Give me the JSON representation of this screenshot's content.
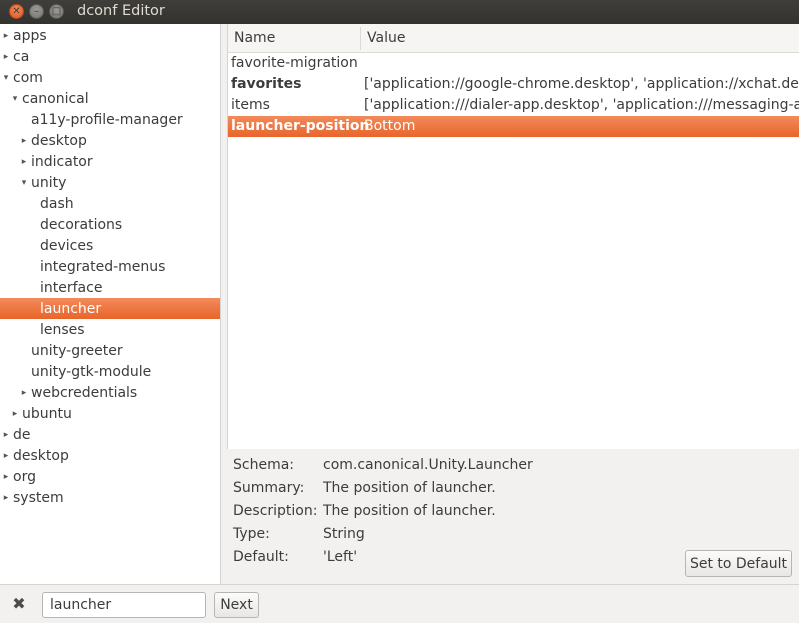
{
  "window": {
    "title": "dconf Editor",
    "close_glyph": "✕",
    "min_glyph": "–",
    "max_glyph": "□"
  },
  "tree": {
    "items": [
      {
        "label": "apps",
        "arrow": "▸",
        "level": 0
      },
      {
        "label": "ca",
        "arrow": "▸",
        "level": 0
      },
      {
        "label": "com",
        "arrow": "▾",
        "level": 0
      },
      {
        "label": "canonical",
        "arrow": "▾",
        "level": 1
      },
      {
        "label": "a11y-profile-manager",
        "arrow": "",
        "level": 2
      },
      {
        "label": "desktop",
        "arrow": "▸",
        "level": 2
      },
      {
        "label": "indicator",
        "arrow": "▸",
        "level": 2
      },
      {
        "label": "unity",
        "arrow": "▾",
        "level": 2
      },
      {
        "label": "dash",
        "arrow": "",
        "level": 3
      },
      {
        "label": "decorations",
        "arrow": "",
        "level": 3
      },
      {
        "label": "devices",
        "arrow": "",
        "level": 3
      },
      {
        "label": "integrated-menus",
        "arrow": "",
        "level": 3
      },
      {
        "label": "interface",
        "arrow": "",
        "level": 3
      },
      {
        "label": "launcher",
        "arrow": "",
        "level": 3,
        "selected": true
      },
      {
        "label": "lenses",
        "arrow": "",
        "level": 3
      },
      {
        "label": "unity-greeter",
        "arrow": "",
        "level": 2
      },
      {
        "label": "unity-gtk-module",
        "arrow": "",
        "level": 2
      },
      {
        "label": "webcredentials",
        "arrow": "▸",
        "level": 2
      },
      {
        "label": "ubuntu",
        "arrow": "▸",
        "level": 1
      },
      {
        "label": "de",
        "arrow": "▸",
        "level": 0
      },
      {
        "label": "desktop",
        "arrow": "▸",
        "level": 0
      },
      {
        "label": "org",
        "arrow": "▸",
        "level": 0
      },
      {
        "label": "system",
        "arrow": "▸",
        "level": 0
      }
    ]
  },
  "keys": {
    "header_name": "Name",
    "header_value": "Value",
    "rows": [
      {
        "name": "favorite-migration",
        "value": "",
        "bold": false,
        "selected": false
      },
      {
        "name": "favorites",
        "value": "['application://google-chrome.desktop', 'application://xchat.desktop'",
        "bold": true,
        "selected": false
      },
      {
        "name": "items",
        "value": "['application:///dialer-app.desktop', 'application:///messaging-app.desktop'",
        "bold": false,
        "selected": false
      },
      {
        "name": "launcher-position",
        "value": "Bottom",
        "bold": true,
        "selected": true
      }
    ]
  },
  "details": {
    "schema_label": "Schema:",
    "schema_value": "com.canonical.Unity.Launcher",
    "summary_label": "Summary:",
    "summary_value": "The position of launcher.",
    "description_label": "Description:",
    "description_value": "The position of launcher.",
    "type_label": "Type:",
    "type_value": "String",
    "default_label": "Default:",
    "default_value": "'Left'",
    "set_default_label": "Set to Default"
  },
  "findbar": {
    "close_glyph": "✖",
    "search_value": "launcher",
    "next_label": "Next"
  }
}
